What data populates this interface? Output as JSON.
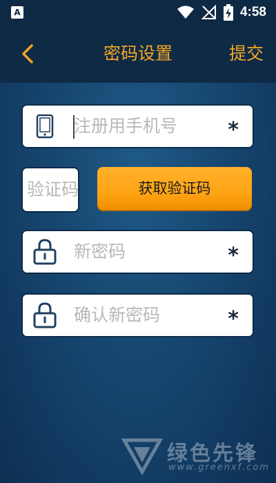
{
  "status_bar": {
    "time": "4:58",
    "app_icon_letter": "A"
  },
  "header": {
    "title": "密码设置",
    "submit_label": "提交",
    "accent_color": "#f5a623"
  },
  "form": {
    "phone": {
      "placeholder": "注册用手机号",
      "value": "",
      "required_mark": "*"
    },
    "code": {
      "placeholder": "验证码",
      "value": ""
    },
    "get_code_label": "获取验证码",
    "new_password": {
      "placeholder": "新密码",
      "value": "",
      "required_mark": "*"
    },
    "confirm_password": {
      "placeholder": "确认新密码",
      "value": "",
      "required_mark": "*"
    }
  },
  "watermark": {
    "name": "绿色先锋",
    "url": "www.greenxf.com"
  },
  "icons": [
    "back-arrow-icon",
    "phone-icon",
    "lock-icon",
    "wifi-icon",
    "signal-off-icon",
    "battery-charging-icon"
  ]
}
